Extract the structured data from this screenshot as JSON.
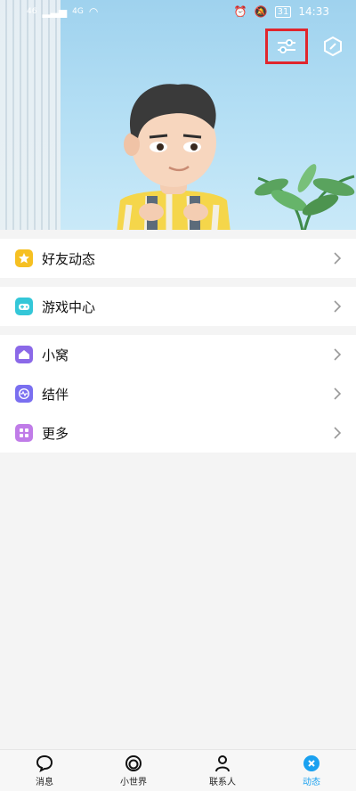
{
  "status_bar": {
    "time": "14:33",
    "battery": "31",
    "network_left": "46",
    "network_right": "4G"
  },
  "colors": {
    "accent": "#1aa1f0",
    "highlight_box": "#e0262d",
    "friends_icon": "#f6c022",
    "game_icon": "#34c7d8",
    "home_icon": "#8b69e8",
    "partner_icon": "#7a6ff0",
    "more_icon": "#c07ce8"
  },
  "menu": {
    "group1": [
      {
        "label": "好友动态",
        "icon": "star-icon"
      }
    ],
    "group2": [
      {
        "label": "游戏中心",
        "icon": "gamepad-icon"
      }
    ],
    "group3": [
      {
        "label": "小窝",
        "icon": "home-icon"
      },
      {
        "label": "结伴",
        "icon": "pulse-icon"
      },
      {
        "label": "更多",
        "icon": "grid-icon"
      }
    ]
  },
  "bottom_nav": [
    {
      "label": "消息",
      "icon": "chat-bubble-icon"
    },
    {
      "label": "小世界",
      "icon": "world-icon"
    },
    {
      "label": "联系人",
      "icon": "person-icon"
    },
    {
      "label": "动态",
      "icon": "dynamic-icon",
      "active": true
    }
  ]
}
